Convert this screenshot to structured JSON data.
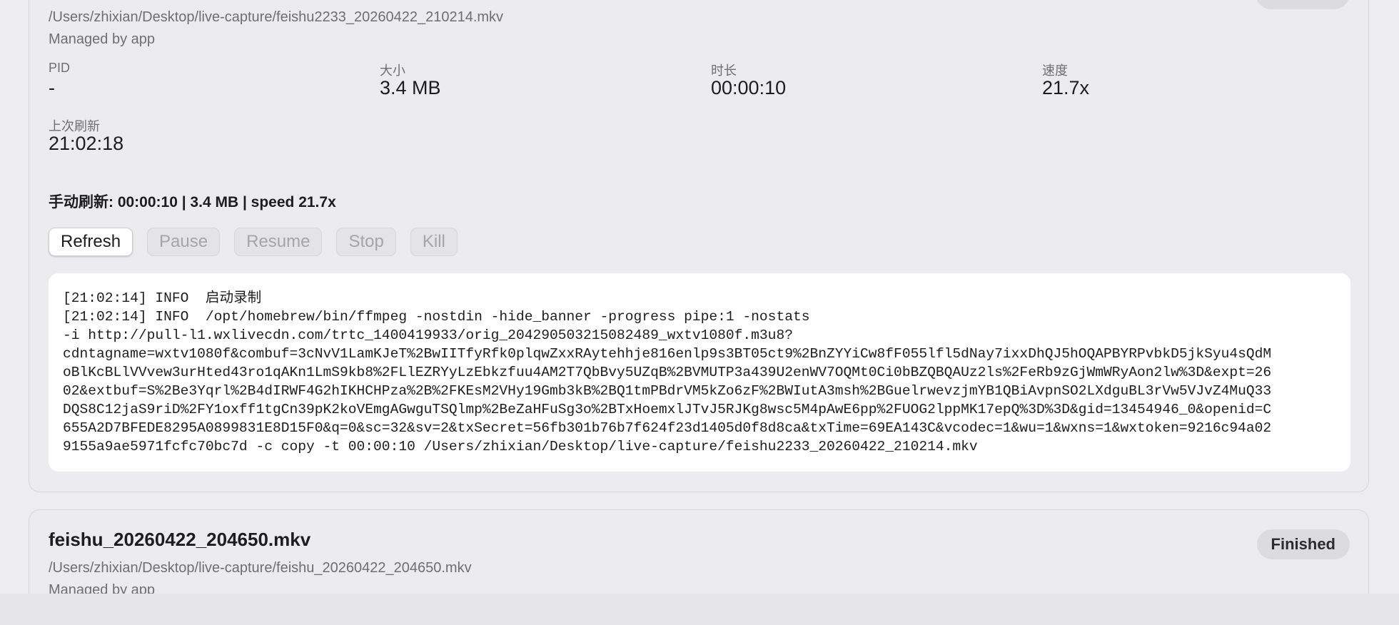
{
  "top_card": {
    "path": "/Users/zhixian/Desktop/live-capture/feishu2233_20260422_210214.mkv",
    "managed": "Managed by app",
    "stats": [
      {
        "label": "PID",
        "value": "-"
      },
      {
        "label": "大小",
        "value": "3.4 MB"
      },
      {
        "label": "时长",
        "value": "00:00:10"
      },
      {
        "label": "速度",
        "value": "21.7x"
      }
    ],
    "last_refresh": {
      "label": "上次刷新",
      "value": "21:02:18"
    },
    "summary": "手动刷新: 00:00:10 | 3.4 MB | speed 21.7x",
    "buttons": {
      "refresh": "Refresh",
      "pause": "Pause",
      "resume": "Resume",
      "stop": "Stop",
      "kill": "Kill"
    },
    "log_lines": [
      "[21:02:14] INFO  启动录制",
      "[21:02:14] INFO  /opt/homebrew/bin/ffmpeg -nostdin -hide_banner -progress pipe:1 -nostats",
      "-i http://pull-l1.wxlivecdn.com/trtc_1400419933/orig_204290503215082489_wxtv1080f.m3u8?",
      "cdntagname=wxtv1080f&combuf=3cNvV1LamKJeT%2BwIITfyRfk0plqwZxxRAytehhje816enlp9s3BT05ct9%2BnZYYiCw8fF055lfl5dNay7ixxDhQJ5hOQAPBYRPvbkD5jkSyu4sQdM",
      "oBlKcBLlVVvew3urHted43ro1qAKn1LmS9kb8%2FLlEZRYyLzEbkzfuu4AM2T7QbBvy5UZqB%2BVMUTP3a439U2enWV7OQMt0Ci0bBZQBQAUz2ls%2FeRb9zGjWmWRyAon2lw%3D&expt=26",
      "02&extbuf=S%2Be3Yqrl%2B4dIRWF4G2hIKHCHPza%2B%2FKEsM2VHy19Gmb3kB%2BQ1tmPBdrVM5kZo6zF%2BWIutA3msh%2BGuelrwevzjmYB1QBiAvpnSO2LXdguBL3rVw5VJvZ4MuQ33",
      "DQS8C12jaS9riD%2FY1oxff1tgCn39pK2koVEmgAGwguTSQlmp%2BeZaHFuSg3o%2BTxHoemxlJTvJ5RJKg8wsc5M4pAwE6pp%2FUOG2lppMK17epQ%3D%3D&gid=13454946_0&openid=C",
      "655A2D7BFEDE8295A0899831E8D15F0&q=0&sc=32&sv=2&txSecret=56fb301b76b7f624f23d1405d0f8d8ca&txTime=69EA143C&vcodec=1&wu=1&wxns=1&wxtoken=9216c94a02",
      "9155a9ae5971fcfc70bc7d -c copy -t 00:00:10 /Users/zhixian/Desktop/live-capture/feishu2233_20260422_210214.mkv"
    ]
  },
  "bottom_card": {
    "title": "feishu_20260422_204650.mkv",
    "status": "Finished",
    "path": "/Users/zhixian/Desktop/live-capture/feishu_20260422_204650.mkv",
    "managed": "Managed by app"
  }
}
